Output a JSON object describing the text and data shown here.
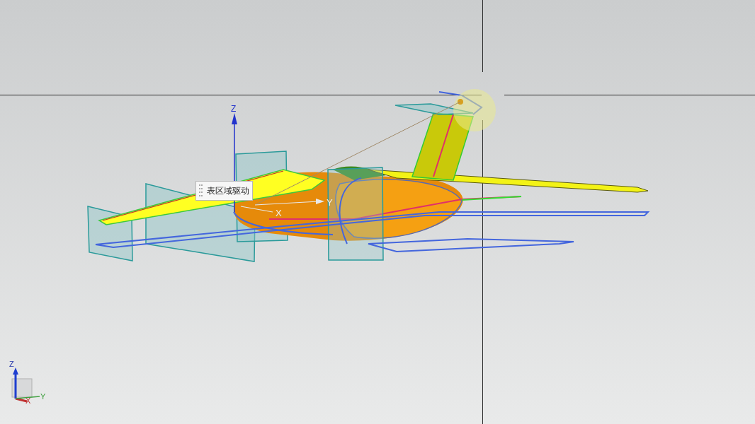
{
  "viewport": {
    "tooltip": "表区域驱动",
    "datum_csys": {
      "z_label": "Z",
      "x_label": "X",
      "y_label": "Y"
    },
    "view_triad": {
      "z_label": "Z",
      "x_label": "X",
      "y_label": "Y"
    }
  }
}
